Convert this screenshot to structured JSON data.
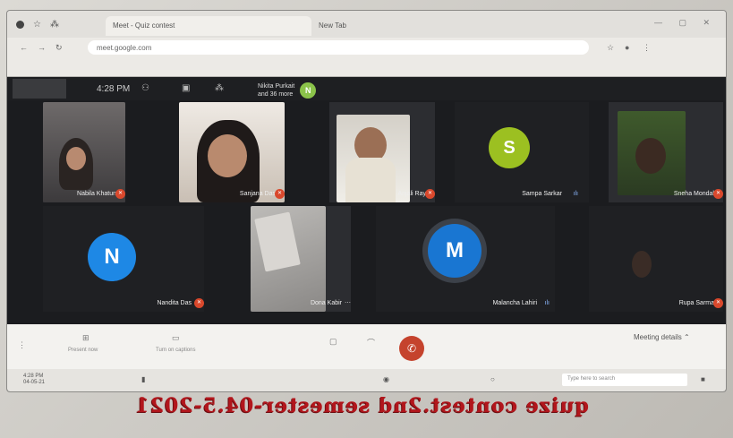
{
  "browser": {
    "tabs": [
      {
        "label": "Meet - Quiz contest"
      },
      {
        "label": "New Tab"
      }
    ],
    "address": "meet.google.com",
    "window_controls": "— ▢ ✕"
  },
  "meet": {
    "time": "4:28 PM",
    "presenter": {
      "initial": "N",
      "line1": "Nikita Purkait",
      "line2": "and 36 more"
    },
    "participants": [
      {
        "name": "Nabila Khatun",
        "type": "video",
        "muted": true
      },
      {
        "name": "Sanjana Das",
        "type": "video",
        "muted": true
      },
      {
        "name": "Anjali Ray",
        "type": "video",
        "muted": true
      },
      {
        "name": "Sampa Sarkar",
        "type": "avatar",
        "initial": "S",
        "color": "#9cc021",
        "speaking": true
      },
      {
        "name": "Sneha Mondal",
        "type": "video",
        "muted": true
      },
      {
        "name": "Nandita Das",
        "type": "avatar",
        "initial": "N",
        "color": "#1e88e5",
        "muted": true
      },
      {
        "name": "Dona Kabir",
        "type": "video",
        "muted": false
      },
      {
        "name": "Malancha Lahiri",
        "type": "avatar",
        "initial": "M",
        "color": "#1976d2",
        "speaking": true
      },
      {
        "name": "Rupa Sarma",
        "type": "video",
        "muted": true
      }
    ],
    "controls": {
      "present_now": "Present now",
      "turn_on_captions": "Turn on captions",
      "meeting_details": "Meeting details"
    }
  },
  "taskbar": {
    "search_placeholder": "Type here to search",
    "tray_time": "4:28 PM",
    "tray_date": "04-05-21"
  },
  "caption": "quize contest.2nd semester-04.5-2021",
  "colors": {
    "meet_bg": "#1b1c1f",
    "end_call": "#c5432d",
    "caption": "#b2161c"
  }
}
